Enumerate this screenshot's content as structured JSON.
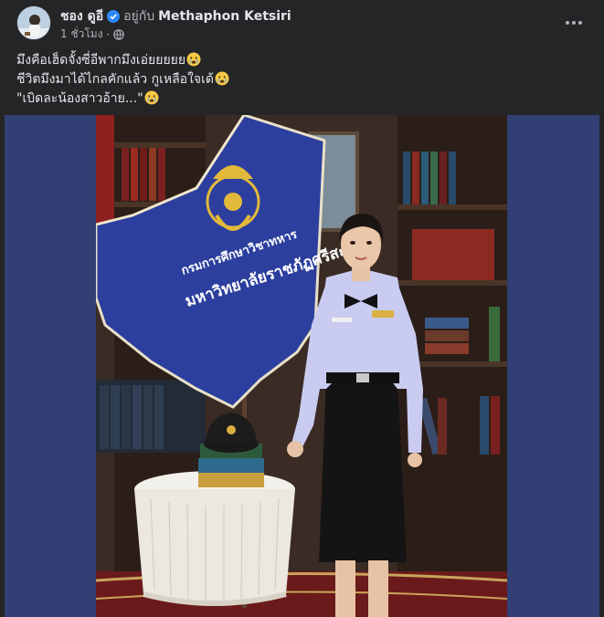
{
  "post": {
    "author_name": "ชอง ดูอี",
    "with_label": "อยู่กับ",
    "tagged_name": "Methaphon Ketsiri",
    "time": "1 ชั่วโมง",
    "separator": "·",
    "privacy_icon": "globe-icon",
    "verified_icon": "verified-badge-icon",
    "more_icon": "more-options-icon"
  },
  "caption": {
    "line1": "มึงคือเฮ็ดจั้งซี่อีพากมึงเอ่ยยยยย",
    "line2": "ชีวิตมึงมาได้ไกลคักแล้ว กูเหลือใจเด้",
    "line3": "\"เบิดละน้องสาวอ้าย...\"",
    "emoji": "crying-face-emoji"
  },
  "photo": {
    "flag_text_line1": "กรมการศึกษาวิชาทหาร",
    "flag_text_line2": "มหาวิทยาลัยราชภัฏศรีสะเกษ",
    "colors": {
      "frame_bg": "#323f74",
      "flag_blue": "#2c3f9e",
      "uniform": "#c9cbf0",
      "skirt": "#141414"
    }
  }
}
